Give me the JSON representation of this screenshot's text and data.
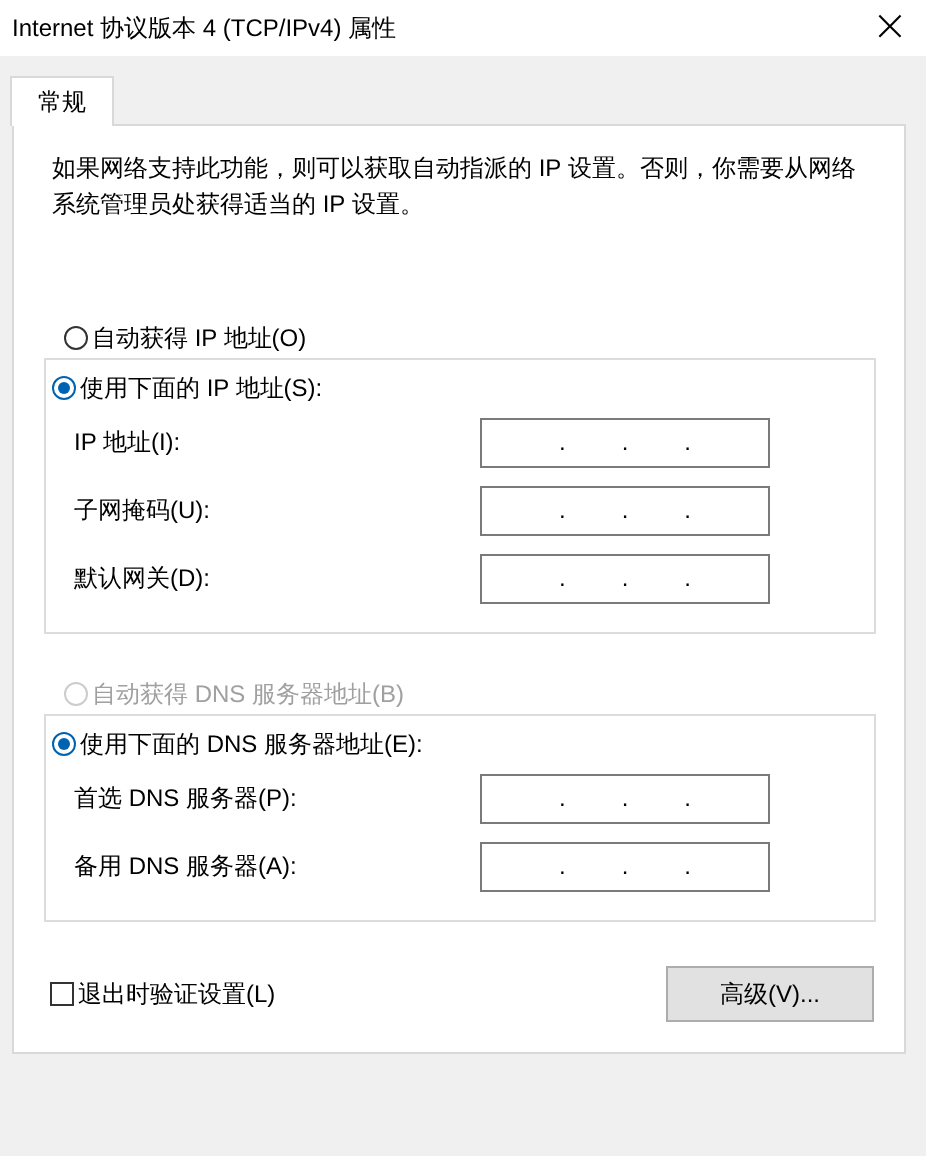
{
  "window": {
    "title": "Internet 协议版本 4 (TCP/IPv4) 属性",
    "close": "×"
  },
  "tabs": [
    {
      "label": "常规",
      "selected": true
    }
  ],
  "description": "如果网络支持此功能，则可以获取自动指派的 IP 设置。否则，你需要从网络系统管理员处获得适当的 IP 设置。",
  "ip_auto": {
    "label": "自动获得 IP 地址(O)",
    "selected": false,
    "disabled": false
  },
  "ip_manual": {
    "label": "使用下面的 IP 地址(S):",
    "selected": true,
    "disabled": false,
    "fields": [
      {
        "label": "IP 地址(I):",
        "dots": [
          ".",
          ".",
          "."
        ]
      },
      {
        "label": "子网掩码(U):",
        "dots": [
          ".",
          ".",
          "."
        ]
      },
      {
        "label": "默认网关(D):",
        "dots": [
          ".",
          ".",
          "."
        ]
      }
    ]
  },
  "dns_auto": {
    "label": "自动获得 DNS 服务器地址(B)",
    "selected": false,
    "disabled": true
  },
  "dns_manual": {
    "label": "使用下面的 DNS 服务器地址(E):",
    "selected": true,
    "disabled": false,
    "fields": [
      {
        "label": "首选 DNS 服务器(P):",
        "dots": [
          ".",
          ".",
          "."
        ]
      },
      {
        "label": "备用 DNS 服务器(A):",
        "dots": [
          ".",
          ".",
          "."
        ]
      }
    ]
  },
  "validate": {
    "label": "退出时验证设置(L)",
    "checked": false
  },
  "advanced_button": "高级(V)..."
}
